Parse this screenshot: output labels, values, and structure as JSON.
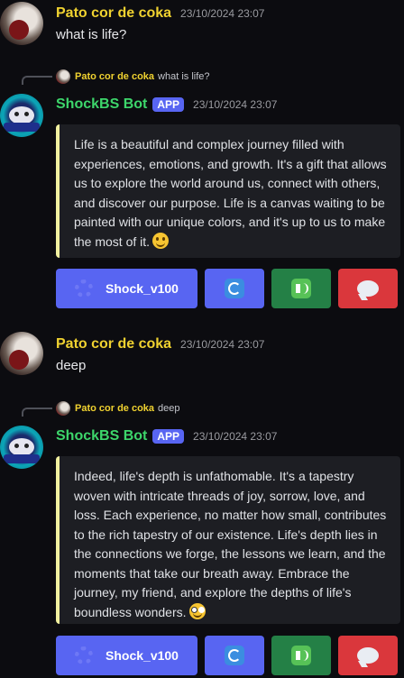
{
  "messages": [
    {
      "author": "Pato cor de coka",
      "timestamp": "23/10/2024 23:07",
      "text": "what is life?"
    },
    {
      "reply_to": {
        "author": "Pato cor de coka",
        "text": "what is life?"
      },
      "author": "ShockBS Bot",
      "badge": "APP",
      "timestamp": "23/10/2024 23:07",
      "embed_text": "Life is a beautiful and complex journey filled with experiences, emotions, and growth. It's a gift that allows us to explore the world around us, connect with others, and discover our purpose. Life is a canvas waiting to be painted with our unique colors, and it's up to us to make the most of it.",
      "embed_emoji": "smile-emoji",
      "buttons": {
        "model_label": "Shock_v100",
        "icons": [
          "refresh-icon",
          "speaker-icon",
          "speech-bubble-icon"
        ]
      }
    },
    {
      "author": "Pato cor de coka",
      "timestamp": "23/10/2024 23:07",
      "text": "deep"
    },
    {
      "reply_to": {
        "author": "Pato cor de coka",
        "text": "deep"
      },
      "author": "ShockBS Bot",
      "badge": "APP",
      "timestamp": "23/10/2024 23:07",
      "embed_text": "Indeed, life's depth is unfathomable. It's a tapestry woven with intricate threads of joy, sorrow, love, and loss. Each experience, no matter how small, contributes to the rich tapestry of our existence. Life's depth lies in the connections we forge, the lessons we learn, and the moments that take our breath away. Embrace the journey, my friend, and explore the depths of life's boundless wonders.",
      "embed_emoji": "nerd-emoji",
      "buttons": {
        "model_label": "Shock_v100",
        "icons": [
          "refresh-icon",
          "speaker-icon",
          "speech-bubble-icon"
        ]
      }
    }
  ],
  "colors": {
    "background": "#0c0c10",
    "username": "#f0d230",
    "botname": "#3dd66b",
    "embed_bg": "#1d1e23",
    "embed_border": "#f1f0a0",
    "blurple": "#5865f2",
    "green": "#248046",
    "red": "#da373c"
  }
}
